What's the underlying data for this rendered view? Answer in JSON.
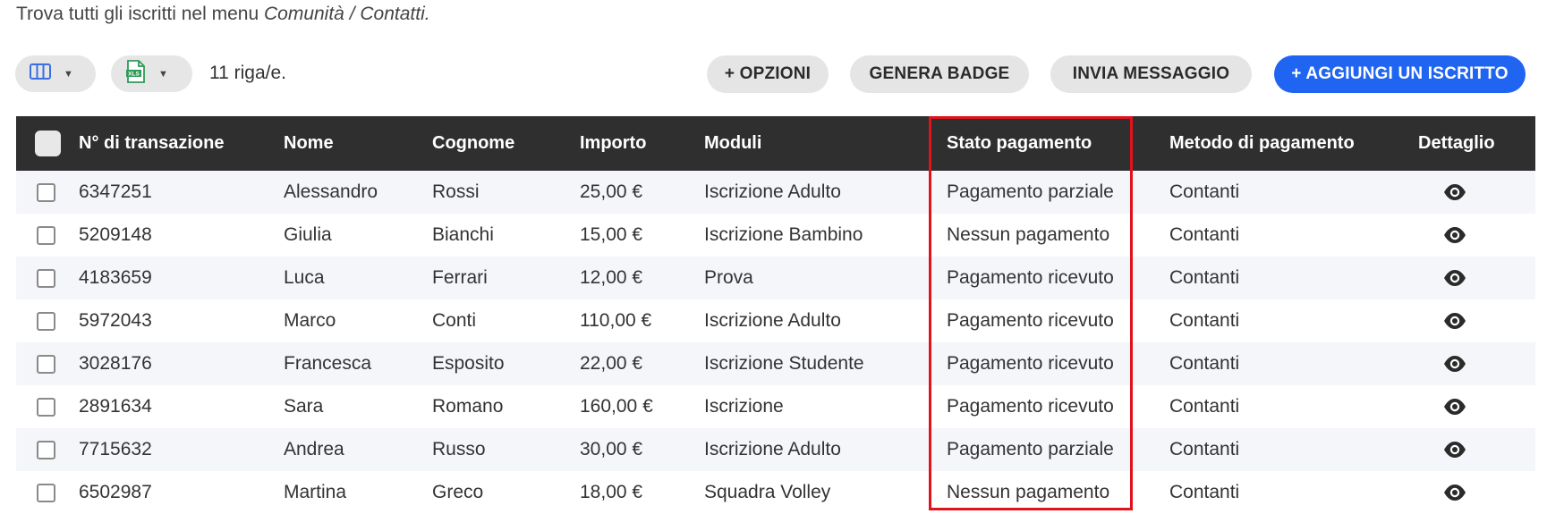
{
  "intro": {
    "text_before": "Trova tutti gli iscritti nel menu ",
    "text_italic": "Comunità / Contatti."
  },
  "toolbar": {
    "columns_selector_icon": "columns-icon",
    "export_selector_icon": "xls-file-icon",
    "row_count": "11 riga/e.",
    "options_label": "+ OPZIONI",
    "badge_label": "GENERA BADGE",
    "message_label": "INVIA MESSAGGIO",
    "add_label": "+ AGGIUNGI UN ISCRITTO"
  },
  "colors": {
    "primary": "#2065f2",
    "header_bg": "#2f2f2f",
    "highlight": "#e0121b",
    "xls_green": "#2e9b57"
  },
  "table": {
    "headers": {
      "transaction": "N° di transazione",
      "first_name": "Nome",
      "last_name": "Cognome",
      "amount": "Importo",
      "forms": "Moduli",
      "payment_status": "Stato pagamento",
      "payment_method": "Metodo di pagamento",
      "detail": "Dettaglio"
    },
    "rows": [
      {
        "id": "6347251",
        "first": "Alessandro",
        "last": "Rossi",
        "amount": "25,00 €",
        "form": "Iscrizione Adulto",
        "status": "Pagamento parziale",
        "method": "Contanti"
      },
      {
        "id": "5209148",
        "first": "Giulia",
        "last": "Bianchi",
        "amount": "15,00 €",
        "form": "Iscrizione Bambino",
        "status": "Nessun pagamento",
        "method": "Contanti"
      },
      {
        "id": "4183659",
        "first": "Luca",
        "last": "Ferrari",
        "amount": "12,00 €",
        "form": "Prova",
        "status": "Pagamento ricevuto",
        "method": "Contanti"
      },
      {
        "id": "5972043",
        "first": "Marco",
        "last": "Conti",
        "amount": "110,00 €",
        "form": "Iscrizione Adulto",
        "status": "Pagamento ricevuto",
        "method": "Contanti"
      },
      {
        "id": "3028176",
        "first": "Francesca",
        "last": "Esposito",
        "amount": "22,00 €",
        "form": "Iscrizione Studente",
        "status": "Pagamento ricevuto",
        "method": "Contanti"
      },
      {
        "id": "2891634",
        "first": "Sara",
        "last": "Romano",
        "amount": "160,00 €",
        "form": "Iscrizione",
        "status": "Pagamento ricevuto",
        "method": "Contanti"
      },
      {
        "id": "7715632",
        "first": "Andrea",
        "last": "Russo",
        "amount": "30,00 €",
        "form": "Iscrizione Adulto",
        "status": "Pagamento parziale",
        "method": "Contanti"
      },
      {
        "id": "6502987",
        "first": "Martina",
        "last": "Greco",
        "amount": "18,00 €",
        "form": "Squadra Volley",
        "status": "Nessun pagamento",
        "method": "Contanti"
      }
    ],
    "detail_icon": "eye-icon"
  }
}
